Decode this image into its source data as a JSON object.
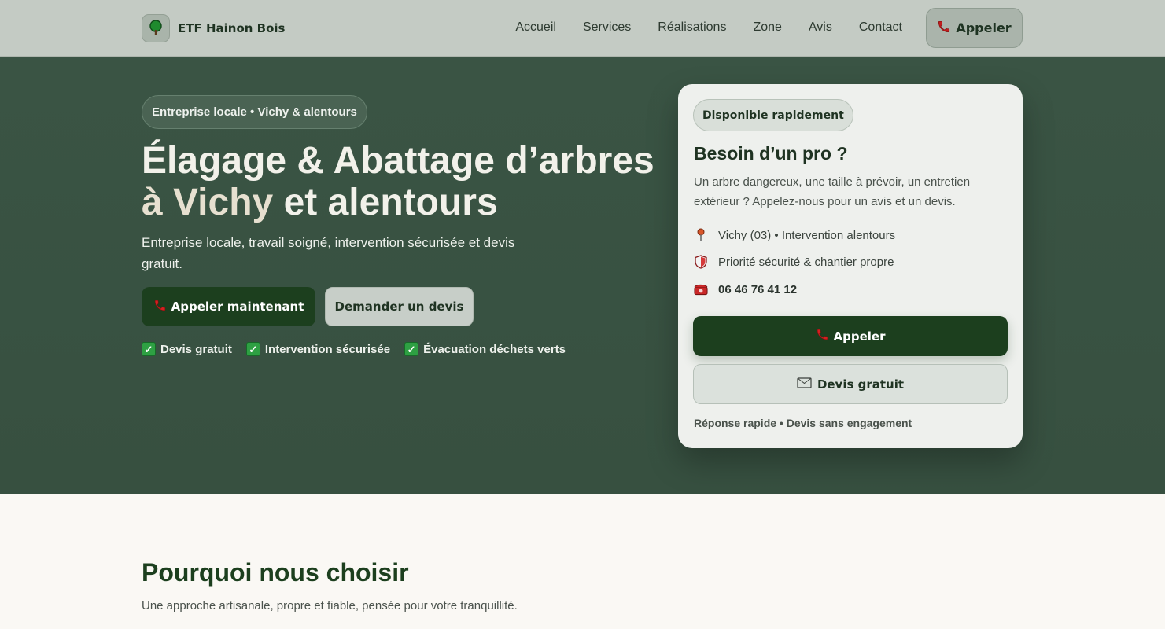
{
  "brand": {
    "name": "ETF Hainon Bois",
    "icon": "tree-icon"
  },
  "nav": {
    "items": [
      {
        "label": "Accueil"
      },
      {
        "label": "Services"
      },
      {
        "label": "Réalisations"
      },
      {
        "label": "Zone"
      },
      {
        "label": "Avis"
      },
      {
        "label": "Contact"
      }
    ],
    "call_label": "Appeler"
  },
  "hero": {
    "pill": "Entreprise locale • Vichy & alentours",
    "title_line1": "Élagage & Abattage d’arbres",
    "title_line2_accent": "à Vichy",
    "title_line2_rest": " et alentours",
    "subtitle": "Entreprise locale, travail soigné, intervention sécurisée et devis gratuit.",
    "primary_button": "Appeler maintenant",
    "secondary_button": "Demander un devis",
    "checks": [
      "Devis gratuit",
      "Intervention sécurisée",
      "Évacuation déchets verts"
    ]
  },
  "card": {
    "badge": "Disponible rapidement",
    "title": "Besoin d’un pro ?",
    "description": "Un arbre dangereux, une taille à prévoir, un entretien extérieur ? Appelez-nous pour un avis et un devis.",
    "location": "Vichy (03) • Intervention alentours",
    "safety": "Priorité sécurité & chantier propre",
    "phone": "06 46 76 41 12",
    "call_button": "Appeler",
    "quote_button": "Devis gratuit",
    "note": "Réponse rapide • Devis sans engagement"
  },
  "section": {
    "title": "Pourquoi nous choisir",
    "subtitle": "Une approche artisanale, propre et fiable, pensée pour votre tranquillité."
  },
  "colors": {
    "header_bg": "#c4cbc4",
    "hero_bg": "#3a5444",
    "primary": "#1c3f1e",
    "card_bg": "#eef0ed",
    "page_bg": "#faf8f4"
  }
}
